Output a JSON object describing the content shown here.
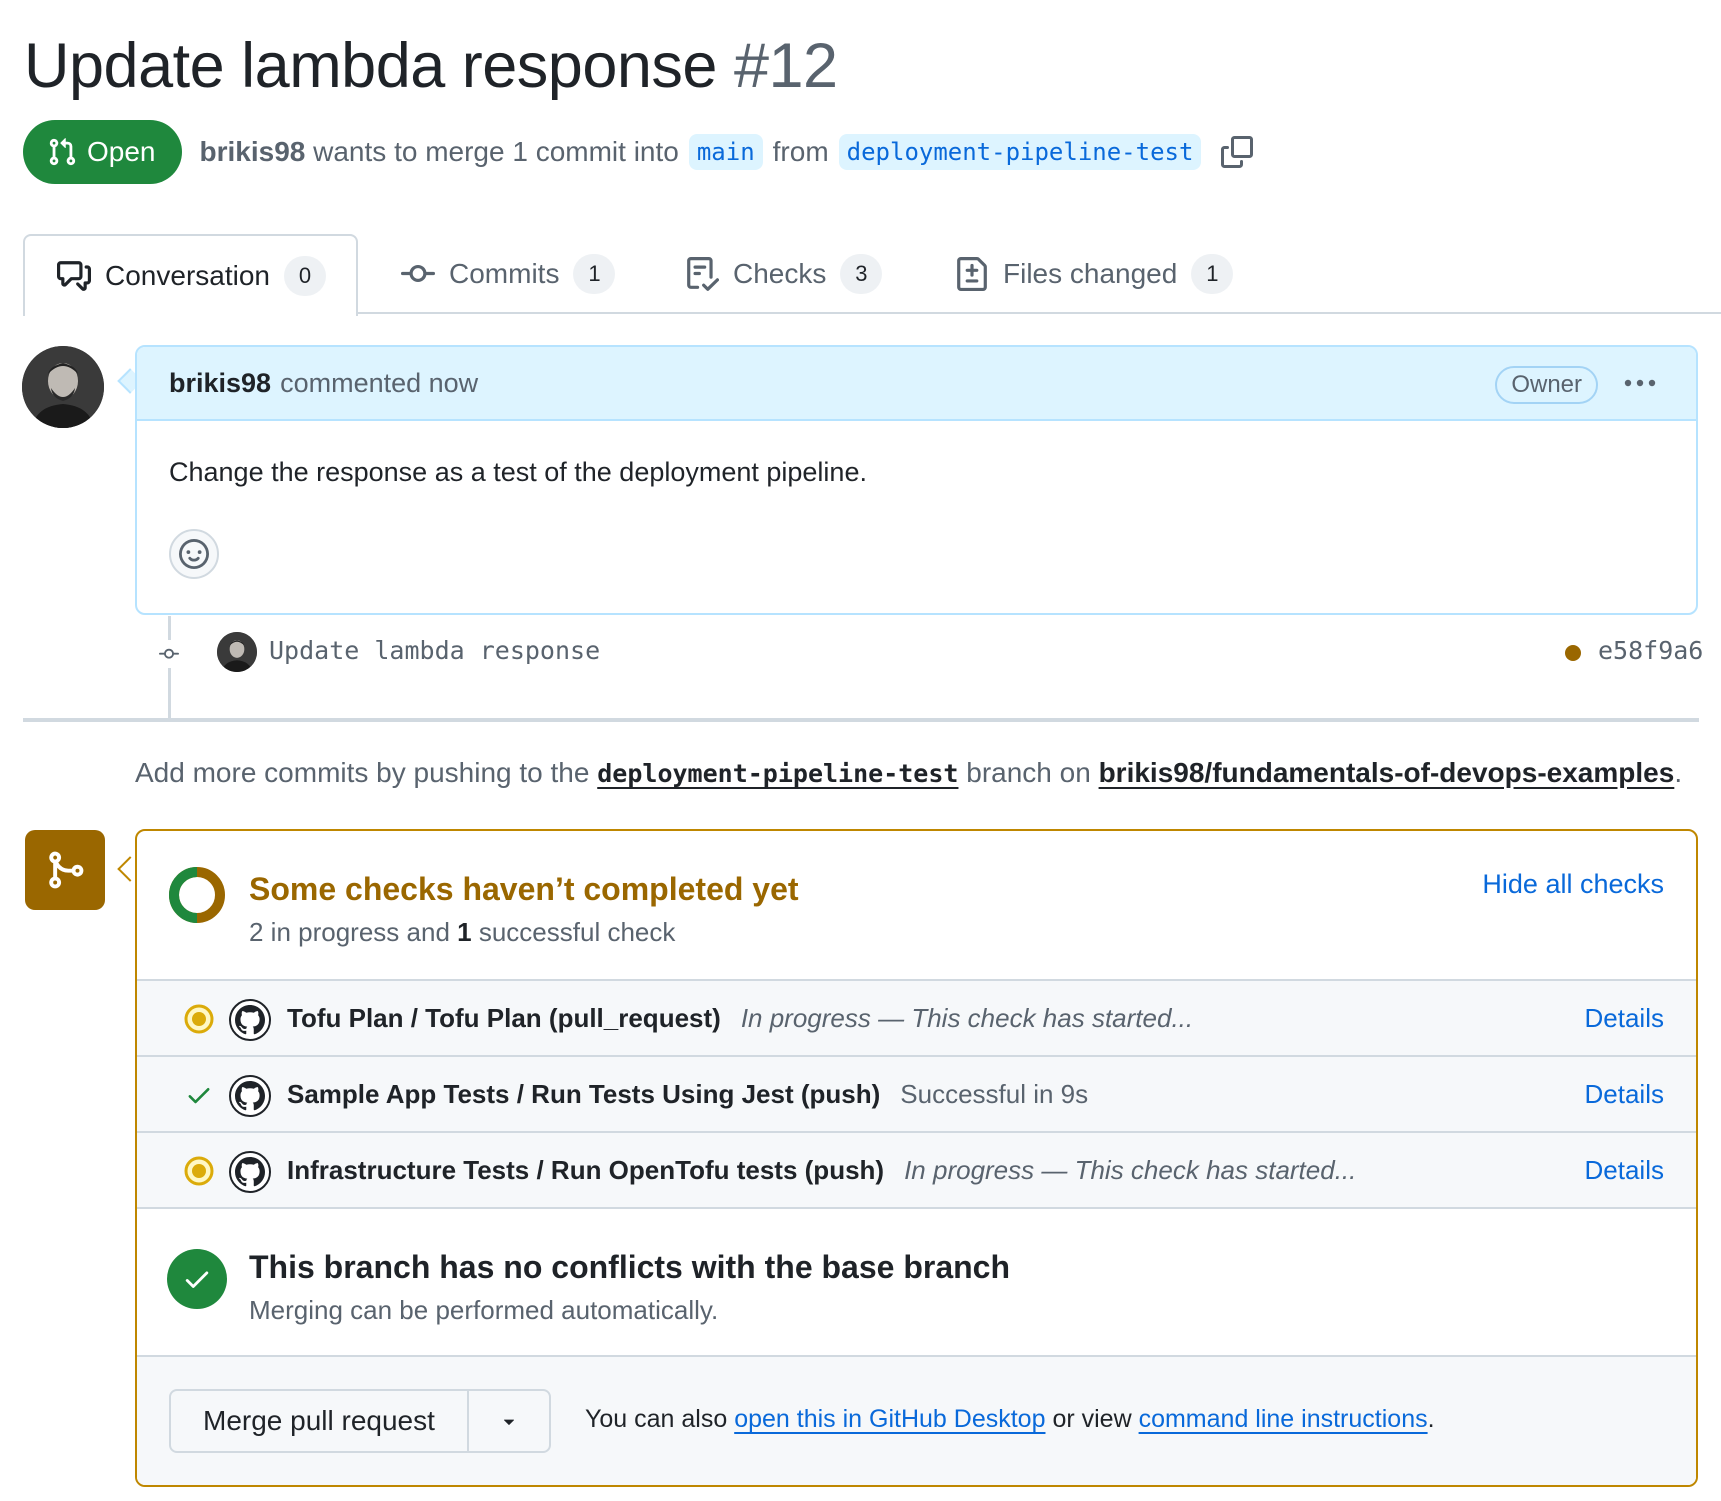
{
  "header": {
    "title": "Update lambda response",
    "number": "#12",
    "state": "Open",
    "author": "brikis98",
    "merge_text": "wants to merge 1 commit into",
    "base_branch": "main",
    "from_text": "from",
    "head_branch": "deployment-pipeline-test"
  },
  "tabs": [
    {
      "label": "Conversation",
      "count": "0",
      "icon": "comment-discussion-icon"
    },
    {
      "label": "Commits",
      "count": "1",
      "icon": "git-commit-icon"
    },
    {
      "label": "Checks",
      "count": "3",
      "icon": "checklist-icon"
    },
    {
      "label": "Files changed",
      "count": "1",
      "icon": "file-diff-icon"
    }
  ],
  "comment": {
    "author": "brikis98",
    "meta": "commented now",
    "badge": "Owner",
    "body": "Change the response as a test of the deployment pipeline."
  },
  "commit": {
    "message": "Update lambda response",
    "sha": "e58f9a6"
  },
  "push_hint": {
    "prefix": "Add more commits by pushing to the",
    "branch": "deployment-pipeline-test",
    "middle": "branch on",
    "repo": "brikis98/fundamentals-of-devops-examples",
    "suffix": "."
  },
  "checks": {
    "title": "Some checks haven’t completed yet",
    "summary_a": "2 in progress and",
    "summary_b": "1",
    "summary_c": "successful check",
    "hide_label": "Hide all checks",
    "items": [
      {
        "name": "Tofu Plan / Tofu Plan (pull_request)",
        "desc": "In progress — This check has started...",
        "status": "in-progress",
        "link": "Details"
      },
      {
        "name": "Sample App Tests / Run Tests Using Jest (push)",
        "desc": "Successful in 9s",
        "status": "success",
        "link": "Details"
      },
      {
        "name": "Infrastructure Tests / Run OpenTofu tests (push)",
        "desc": "In progress — This check has started...",
        "status": "in-progress",
        "link": "Details"
      }
    ]
  },
  "conflicts": {
    "title": "This branch has no conflicts with the base branch",
    "subtitle": "Merging can be performed automatically."
  },
  "merge": {
    "button_label": "Merge pull request",
    "hint_prefix": "You can also",
    "hint_link1": "open this in GitHub Desktop",
    "hint_middle": "or view",
    "hint_link2": "command line instructions",
    "hint_suffix": "."
  },
  "colors": {
    "open_green": "#1f883d",
    "link_blue": "#0969da",
    "pending_amber": "#9a6700",
    "in_progress_yellow": "#dbab0a"
  }
}
